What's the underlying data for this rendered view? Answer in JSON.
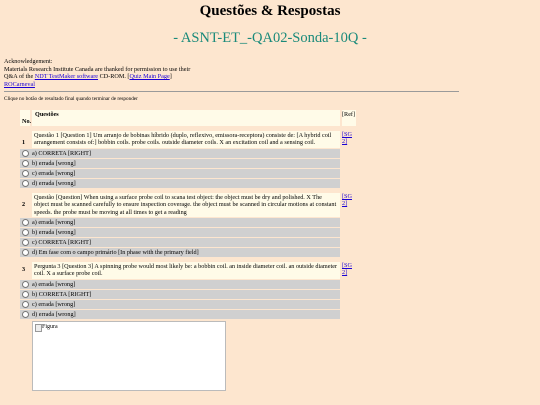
{
  "header": {
    "title": "Questões & Respostas",
    "subtitle": "- ASNT-ET_-QA02-Sonda-10Q -"
  },
  "ack": {
    "line1": "Acknowledgement:",
    "line2": "Materials Research Institute Canada are thanked for permission to use their",
    "line3_prefix": "Q&A of the ",
    "link_software": "NDT TestMaker software",
    "line3_mid": " CD-ROM. [",
    "link_main": "Quiz Main Page",
    "line3_suffix": "]",
    "link_rocarneval": "ROCarneval"
  },
  "instruction": "Clique no botão de resultado final quando terminar de responder",
  "table": {
    "col_no": "No.",
    "col_question": "Questões",
    "col_ref": "[Ref]"
  },
  "questions": [
    {
      "number": "1",
      "text": "Questão 1 [Question 1] Um arranjo de bobinas híbrido (duplo, reflexivo, emissora-receptora) consiste de: [A hybrid coil arrangement consists of:] bobbin coils. probe coils. outside diameter coils. X an excitation coil and a sensing coil.",
      "ref": "[SG2]",
      "options": [
        "a) CORRETA [RIGHT]",
        "b) errada [wrong]",
        "c) errada [wrong]",
        "d) errada [wrong]"
      ]
    },
    {
      "number": "2",
      "text": "Questão [Question] When using a surface probe coil to scana test object: the object must be dry and polished. X The object must be scanned carefully to ensure inspection coverage. the object must be scanned in circular motions at constant speeds. the probe must be moving at all times to get a reading",
      "ref": "[SG2]",
      "options": [
        "a) errada [wrong]",
        "b) errada [wrong]",
        "c) CORRETA [RIGHT]",
        "d) Em fase com o campo primário [In phase with the primary field]"
      ]
    },
    {
      "number": "3",
      "text": "Pergunta 3 [Question 3] A spinning probe would most likely be: a bobbin coil. an inside diameter coil. an outside diameter coil. X a surface probe coil.",
      "ref": "[SG2]",
      "options": [
        "a) errada [wrong]",
        "b) CORRETA [RIGHT]",
        "c) errada [wrong]",
        "d) errada [wrong]"
      ]
    }
  ],
  "figure": {
    "alt": "Figura"
  },
  "colors": {
    "background": "#fde6cf",
    "subtitle": "#1a8a7a",
    "option_bg": "#d0d0d0",
    "question_bg": "#fffbe8",
    "link": "#1a00d6"
  }
}
